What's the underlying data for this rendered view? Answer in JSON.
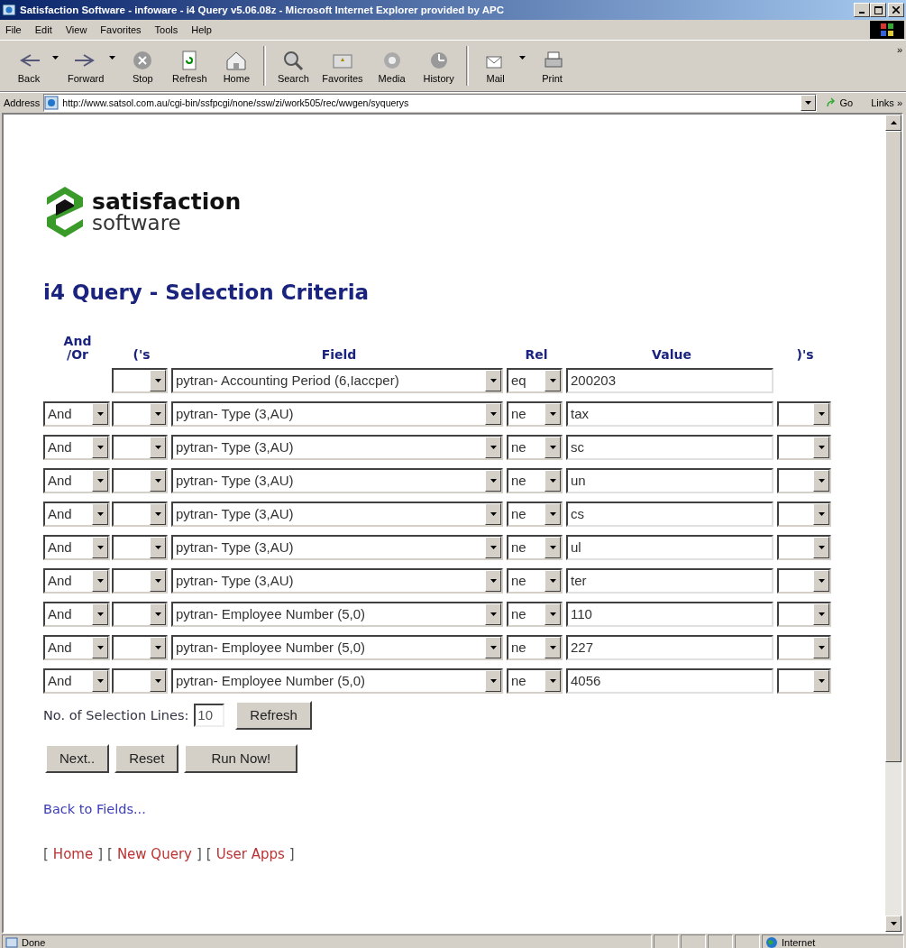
{
  "window": {
    "title": "Satisfaction Software - infoware - i4 Query v5.06.08z - Microsoft Internet Explorer provided by APC"
  },
  "menu": [
    "File",
    "Edit",
    "View",
    "Favorites",
    "Tools",
    "Help"
  ],
  "toolbar": [
    {
      "label": "Back",
      "has_menu": true
    },
    {
      "label": "Forward",
      "has_menu": true
    },
    {
      "label": "Stop",
      "has_menu": false
    },
    {
      "label": "Refresh",
      "has_menu": false
    },
    {
      "label": "Home",
      "has_menu": false
    },
    {
      "label": "Search",
      "has_menu": false
    },
    {
      "label": "Favorites",
      "has_menu": false
    },
    {
      "label": "Media",
      "has_menu": false
    },
    {
      "label": "History",
      "has_menu": false
    },
    {
      "label": "Mail",
      "has_menu": true
    },
    {
      "label": "Print",
      "has_menu": false
    }
  ],
  "toolbar_more": "»",
  "address_bar": {
    "label": "Address",
    "url": "http://www.satsol.com.au/cgi-bin/ssfpcgi/none/ssw/zi/work505/rec/wwgen/syquerys",
    "go": "Go",
    "links": "Links »"
  },
  "logo": {
    "name": "satisfaction",
    "tagline": "software"
  },
  "heading": "i4 Query - Selection Criteria",
  "columns": [
    "And\n/Or",
    "('s",
    "Field",
    "Rel",
    "Value",
    ")'s"
  ],
  "rows": [
    {
      "field": "pytran- Accounting Period (6,Iaccper)",
      "rel": "eq",
      "value": "200203",
      "close_paren": false
    },
    {
      "connector": "And",
      "field": "pytran- Type (3,AU)",
      "rel": "ne",
      "value": "tax",
      "close_paren": true
    },
    {
      "connector": "And",
      "field": "pytran- Type (3,AU)",
      "rel": "ne",
      "value": "sc",
      "close_paren": true
    },
    {
      "connector": "And",
      "field": "pytran- Type (3,AU)",
      "rel": "ne",
      "value": "un",
      "close_paren": true
    },
    {
      "connector": "And",
      "field": "pytran- Type (3,AU)",
      "rel": "ne",
      "value": "cs",
      "close_paren": true
    },
    {
      "connector": "And",
      "field": "pytran- Type (3,AU)",
      "rel": "ne",
      "value": "ul",
      "close_paren": true
    },
    {
      "connector": "And",
      "field": "pytran- Type (3,AU)",
      "rel": "ne",
      "value": "ter",
      "close_paren": true
    },
    {
      "connector": "And",
      "field": "pytran- Employee Number (5,0)",
      "rel": "ne",
      "value": "110",
      "close_paren": true
    },
    {
      "connector": "And",
      "field": "pytran- Employee Number (5,0)",
      "rel": "ne",
      "value": "227",
      "close_paren": true
    },
    {
      "connector": "And",
      "field": "pytran- Employee Number (5,0)",
      "rel": "ne",
      "value": "4056",
      "close_paren": true
    }
  ],
  "selection_lines": {
    "label": "No. of Selection Lines:",
    "value": "10",
    "button": "Refresh"
  },
  "buttons": [
    "Next..",
    "Reset",
    "Run Now!"
  ],
  "back_link": "Back to Fields...",
  "footer_links": [
    {
      "open": "[",
      "label": "Home",
      "close": "]"
    },
    {
      "open": "[",
      "label": "New Query",
      "close": "]"
    },
    {
      "open": "[",
      "label": "User Apps",
      "close": "]"
    }
  ],
  "status_bar": {
    "text": "Done",
    "zone": "Internet"
  }
}
